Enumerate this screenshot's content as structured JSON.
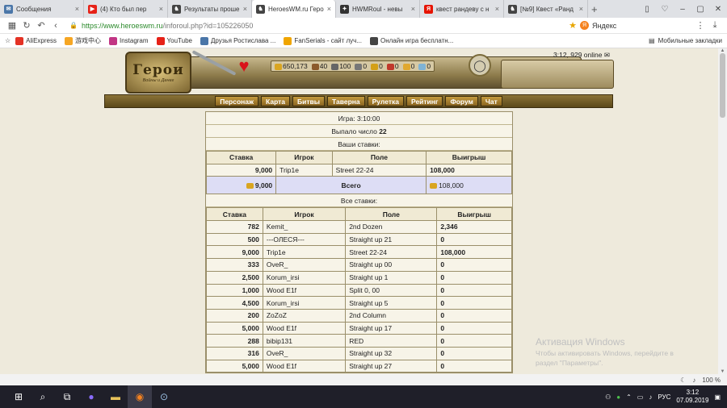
{
  "tabs": [
    {
      "label": "Сообщения",
      "color": "#4a76a8",
      "glyph": "✉",
      "active": false
    },
    {
      "label": "(4) Кто был пер",
      "color": "#e62117",
      "glyph": "▶",
      "active": false
    },
    {
      "label": "Результаты проше",
      "color": "#444",
      "glyph": "♞",
      "active": false
    },
    {
      "label": "HeroesWM.ru Геро",
      "color": "#444",
      "glyph": "♞",
      "active": true
    },
    {
      "label": "HWMRoul - невы",
      "color": "#333",
      "glyph": "✦",
      "active": false
    },
    {
      "label": "квест рандеву с н",
      "color": "#e61400",
      "glyph": "Я",
      "active": false
    },
    {
      "label": "[№9] Квест «Ранд",
      "color": "#444",
      "glyph": "♞",
      "active": false
    }
  ],
  "address": {
    "domain": "https://www.heroeswm.ru",
    "path": "/inforoul.php?id=105226050",
    "search_engine": "Яндекс"
  },
  "bookmarks": [
    {
      "label": "AliExpress",
      "color": "#e43225"
    },
    {
      "label": "游戏中心",
      "color": "#f6a623"
    },
    {
      "label": "Instagram",
      "color": "#c13584"
    },
    {
      "label": "YouTube",
      "color": "#e62117"
    },
    {
      "label": "Друзья Ростислава ...",
      "color": "#4a76a8"
    },
    {
      "label": "FanSerials - сайт луч...",
      "color": "#f0a500"
    },
    {
      "label": "Онлайн игра бесплатн...",
      "color": "#444"
    }
  ],
  "bookmarks_right": "Мобильные закладки",
  "game": {
    "logo_title": "Герои",
    "logo_sub": "Войны и Денег",
    "online": "3:12, 929 online",
    "resources": [
      {
        "value": "650,173",
        "color": "#d9a520"
      },
      {
        "value": "40",
        "color": "#8b5a2b"
      },
      {
        "value": "100",
        "color": "#666"
      },
      {
        "value": "0",
        "color": "#777"
      },
      {
        "value": "0",
        "color": "#d4a017"
      },
      {
        "value": "0",
        "color": "#c0392b"
      },
      {
        "value": "0",
        "color": "#e0a82e"
      },
      {
        "value": "0",
        "color": "#7fb3d5"
      }
    ],
    "menu": [
      "Персонаж",
      "Карта",
      "Битвы",
      "Таверна",
      "Рулетка",
      "Рейтинг",
      "Форум",
      "Чат"
    ]
  },
  "roulette": {
    "game_label": "Игра: 3:10:00",
    "drawn_prefix": "Выпало число",
    "drawn_number": "22",
    "your_bets_label": "Ваши ставки:",
    "all_bets_label": "Все ставки:",
    "total_label": "Всего",
    "columns": [
      "Ставка",
      "Игрок",
      "Поле",
      "Выигрыш"
    ],
    "your_bets": [
      {
        "bet": "9,000",
        "player": "Trip1e",
        "field": "Street 22-24",
        "win": "108,000"
      }
    ],
    "total": {
      "bet": "9,000",
      "win": "108,000"
    },
    "all_bets": [
      {
        "bet": "782",
        "player": "Kemit_",
        "field": "2nd Dozen",
        "win": "2,346"
      },
      {
        "bet": "500",
        "player": "---ОЛЕСЯ---",
        "field": "Straight up 21",
        "win": "0"
      },
      {
        "bet": "9,000",
        "player": "Trip1e",
        "field": "Street 22-24",
        "win": "108,000"
      },
      {
        "bet": "333",
        "player": "OveR_",
        "field": "Straight up 00",
        "win": "0"
      },
      {
        "bet": "2,500",
        "player": "Korum_irsi",
        "field": "Straight up 1",
        "win": "0"
      },
      {
        "bet": "1,000",
        "player": "Wood E1f",
        "field": "Split 0, 00",
        "win": "0"
      },
      {
        "bet": "4,500",
        "player": "Korum_irsi",
        "field": "Straight up 5",
        "win": "0"
      },
      {
        "bet": "200",
        "player": "ZoZoZ",
        "field": "2nd Column",
        "win": "0"
      },
      {
        "bet": "5,000",
        "player": "Wood E1f",
        "field": "Straight up 17",
        "win": "0"
      },
      {
        "bet": "288",
        "player": "bibip131",
        "field": "RED",
        "win": "0"
      },
      {
        "bet": "316",
        "player": "OveR_",
        "field": "Straight up 32",
        "win": "0"
      },
      {
        "bet": "5,000",
        "player": "Wood E1f",
        "field": "Straight up 27",
        "win": "0"
      }
    ]
  },
  "watermark": {
    "title": "Активация Windows",
    "line1": "Чтобы активировать Windows, перейдите в",
    "line2": "раздел \"Параметры\"."
  },
  "zoom": "100 %",
  "taskbar": {
    "lang": "РУС",
    "time": "3:12",
    "date": "07.09.2019"
  }
}
